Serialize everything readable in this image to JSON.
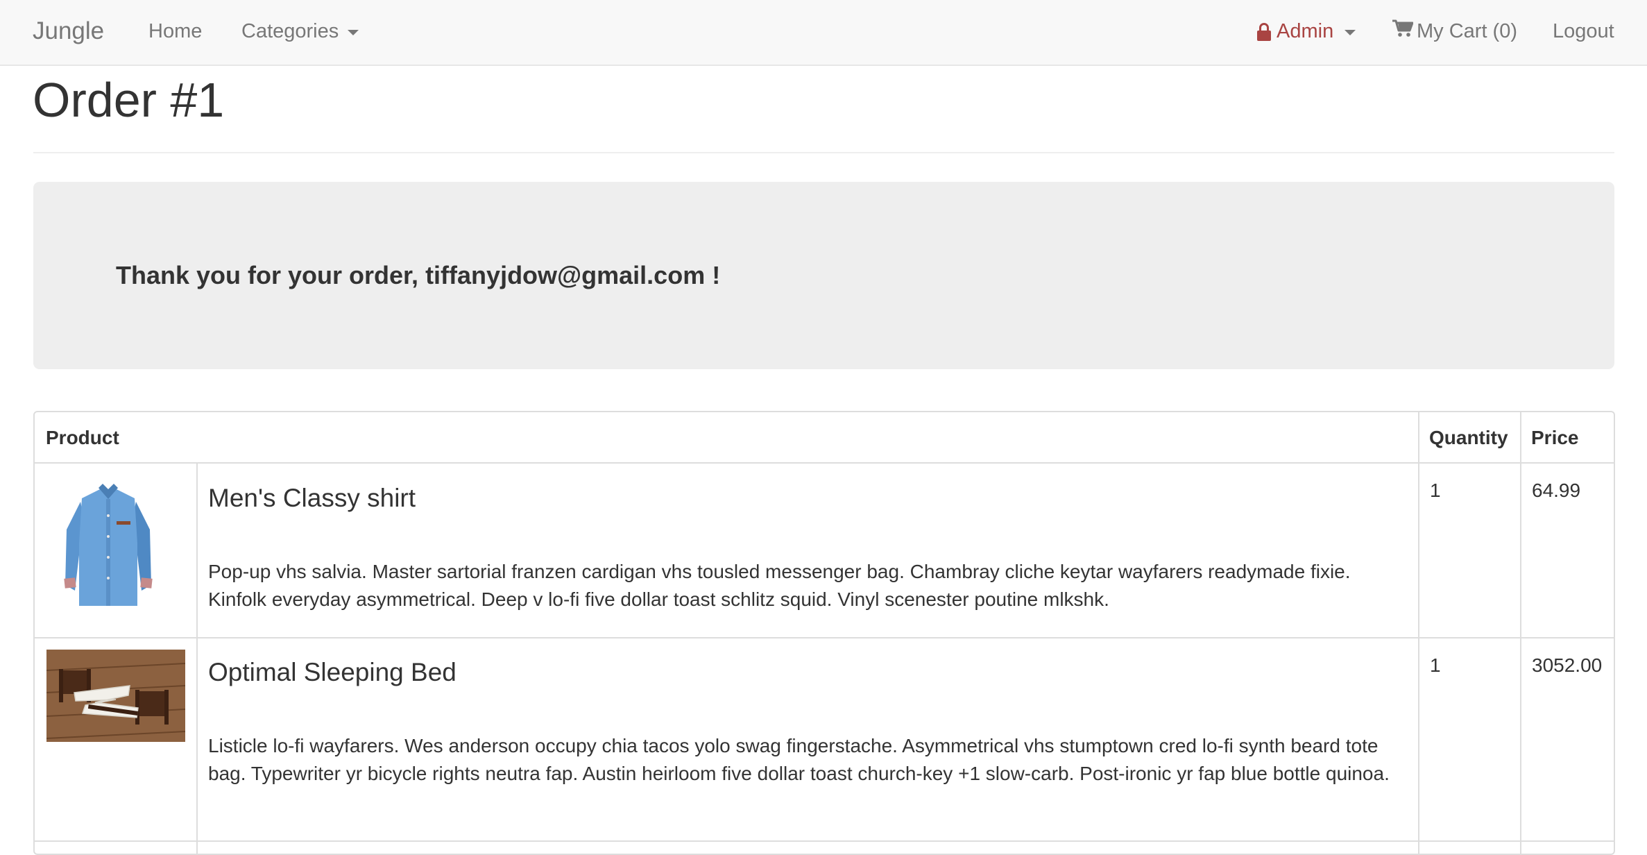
{
  "navbar": {
    "brand": "Jungle",
    "home": "Home",
    "categories": "Categories",
    "admin": "Admin",
    "cart": "My Cart (0)",
    "logout": "Logout"
  },
  "page": {
    "title": "Order #1"
  },
  "jumbotron": {
    "message": "Thank you for your order, tiffanyjdow@gmail.com !"
  },
  "table": {
    "headers": {
      "product": "Product",
      "quantity": "Quantity",
      "price": "Price"
    },
    "rows": [
      {
        "name": "Men's Classy shirt",
        "description": "Pop-up vhs salvia. Master sartorial franzen cardigan vhs tousled messenger bag. Chambray cliche keytar wayfarers readymade fixie. Kinfolk everyday asymmetrical. Deep v lo-fi five dollar toast schlitz squid. Vinyl scenester poutine mlkshk.",
        "quantity": "1",
        "price": "64.99",
        "image": "blue-denim-shirt"
      },
      {
        "name": "Optimal Sleeping Bed",
        "description": "Listicle lo-fi wayfarers. Wes anderson occupy chia tacos yolo swag fingerstache. Asymmetrical vhs stumptown cred lo-fi synth beard tote bag. Typewriter yr bicycle rights neutra fap. Austin heirloom five dollar toast church-key +1 slow-carb. Post-ironic yr fap blue bottle quinoa.",
        "quantity": "1",
        "price": "3052.00",
        "image": "z-shaped-bed"
      }
    ]
  },
  "colors": {
    "navbar_bg": "#f8f8f8",
    "nav_text": "#777777",
    "admin_text": "#a94442",
    "jumbotron_bg": "#eeeeee",
    "table_border": "#dddddd"
  }
}
